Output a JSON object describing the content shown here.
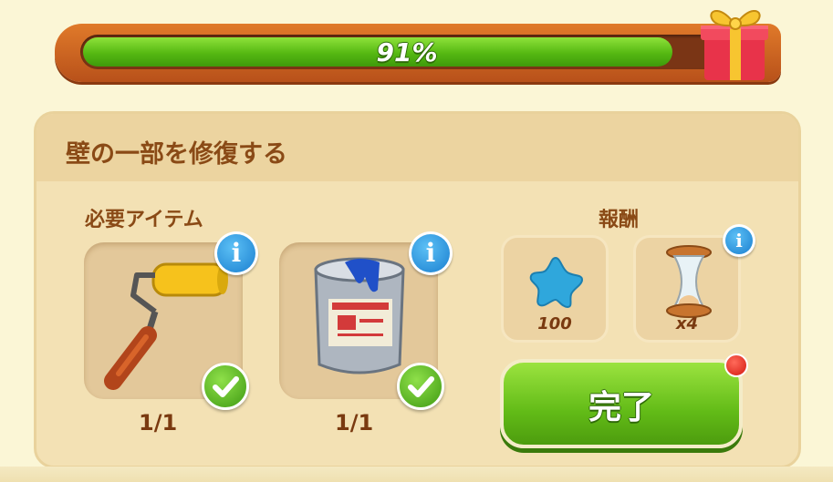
{
  "progress": {
    "value": 0.91,
    "label": "91%"
  },
  "task": {
    "title": "壁の一部を修復する",
    "required_label": "必要アイテム",
    "reward_label": "報酬",
    "items": [
      {
        "icon": "paint-roller-icon",
        "count": "1/1",
        "complete": true
      },
      {
        "icon": "paint-can-icon",
        "count": "1/1",
        "complete": true
      }
    ],
    "rewards": [
      {
        "icon": "blue-star-icon",
        "count": "100"
      },
      {
        "icon": "hourglass-icon",
        "count": "x4"
      }
    ],
    "complete_button": "完了",
    "info_glyph": "i"
  },
  "colors": {
    "progress_fill": "#55b812",
    "panel": "#f3e1b4",
    "title": "#8a4a16",
    "button": "#62bb17"
  }
}
